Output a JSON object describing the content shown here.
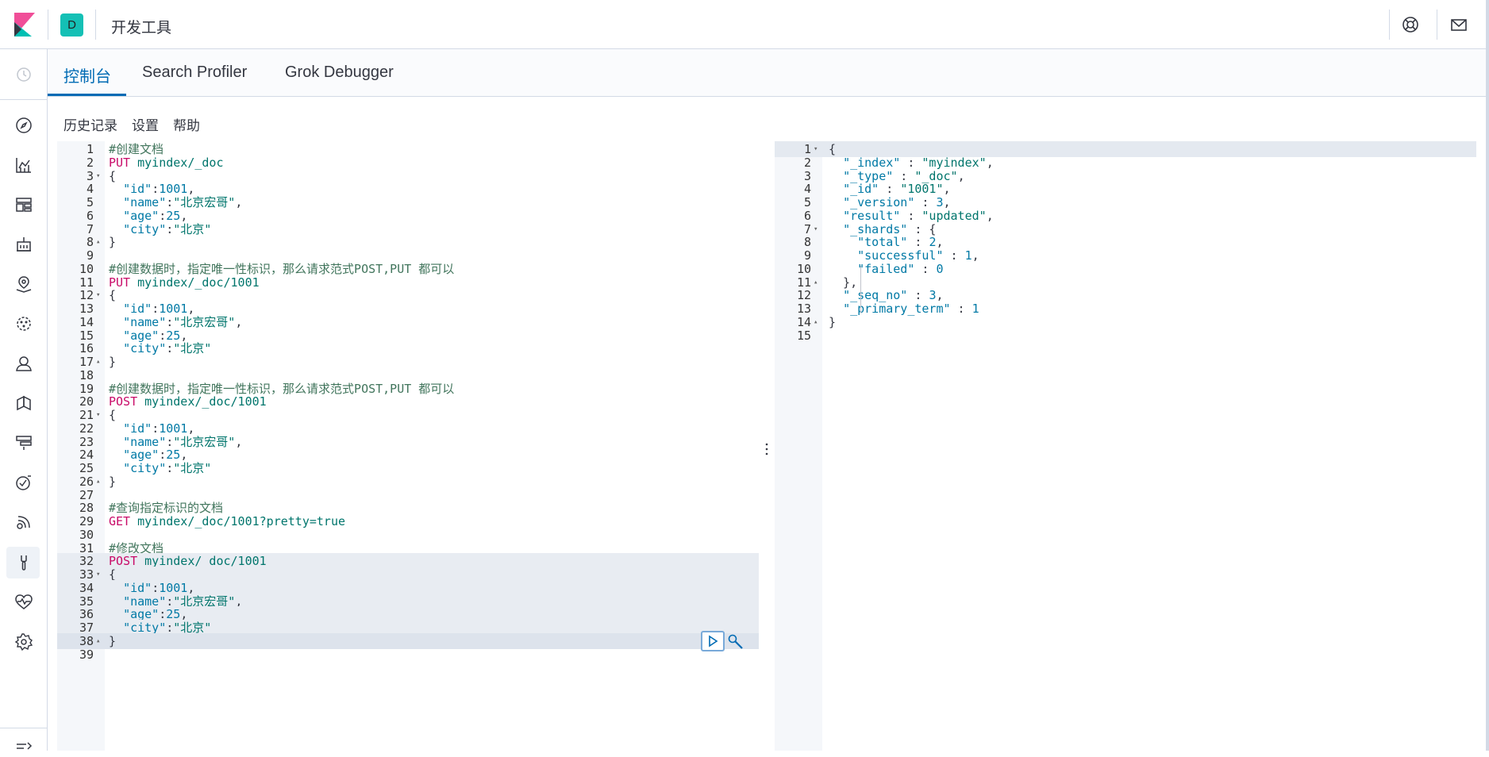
{
  "header": {
    "space_initial": "D",
    "app_title": "开发工具",
    "icons": [
      "kibana-logo-icon",
      "help-lifebuoy-icon",
      "mail-icon"
    ]
  },
  "sidenav": {
    "icons": [
      "clock-icon",
      "compass-icon",
      "visualize-icon",
      "dashboard-icon",
      "canvas-icon",
      "maps-icon",
      "ml-icon",
      "metrics-icon",
      "logs-icon",
      "apm-icon",
      "uptime-icon",
      "siem-icon",
      "dev-tools-icon",
      "monitoring-icon",
      "settings-gear-icon",
      "collapse-icon"
    ]
  },
  "tabs": [
    {
      "label": "控制台",
      "active": true
    },
    {
      "label": "Search Profiler",
      "active": false
    },
    {
      "label": "Grok Debugger",
      "active": false
    }
  ],
  "subnav": {
    "history": "历史记录",
    "settings": "设置",
    "help": "帮助"
  },
  "editor": {
    "lines": [
      {
        "n": "1",
        "fold": "",
        "tokens": [
          [
            "#创建文档",
            "comment"
          ]
        ]
      },
      {
        "n": "2",
        "fold": "",
        "tokens": [
          [
            "PUT ",
            "method"
          ],
          [
            "myindex/_doc",
            "path"
          ]
        ]
      },
      {
        "n": "3",
        "fold": "▾",
        "tokens": [
          [
            "{",
            "punc"
          ]
        ]
      },
      {
        "n": "4",
        "fold": "",
        "tokens": [
          [
            "  ",
            "punc"
          ],
          [
            "\"id\"",
            "key"
          ],
          [
            ":",
            "punc"
          ],
          [
            "1001",
            "num"
          ],
          [
            ",",
            "punc"
          ]
        ]
      },
      {
        "n": "5",
        "fold": "",
        "tokens": [
          [
            "  ",
            "punc"
          ],
          [
            "\"name\"",
            "key"
          ],
          [
            ":",
            "punc"
          ],
          [
            "\"北京宏哥\"",
            "str"
          ],
          [
            ",",
            "punc"
          ]
        ]
      },
      {
        "n": "6",
        "fold": "",
        "tokens": [
          [
            "  ",
            "punc"
          ],
          [
            "\"age\"",
            "key"
          ],
          [
            ":",
            "punc"
          ],
          [
            "25",
            "num"
          ],
          [
            ",",
            "punc"
          ]
        ]
      },
      {
        "n": "7",
        "fold": "",
        "tokens": [
          [
            "  ",
            "punc"
          ],
          [
            "\"city\"",
            "key"
          ],
          [
            ":",
            "punc"
          ],
          [
            "\"北京\"",
            "str"
          ]
        ]
      },
      {
        "n": "8",
        "fold": "▴",
        "tokens": [
          [
            "}",
            "punc"
          ]
        ]
      },
      {
        "n": "9",
        "fold": "",
        "tokens": []
      },
      {
        "n": "10",
        "fold": "",
        "tokens": [
          [
            "#创建数据时，指定唯一性标识，那么请求范式POST,PUT 都可以",
            "comment"
          ]
        ]
      },
      {
        "n": "11",
        "fold": "",
        "tokens": [
          [
            "PUT ",
            "method"
          ],
          [
            "myindex/_doc/1001",
            "path"
          ]
        ]
      },
      {
        "n": "12",
        "fold": "▾",
        "tokens": [
          [
            "{",
            "punc"
          ]
        ]
      },
      {
        "n": "13",
        "fold": "",
        "tokens": [
          [
            "  ",
            "punc"
          ],
          [
            "\"id\"",
            "key"
          ],
          [
            ":",
            "punc"
          ],
          [
            "1001",
            "num"
          ],
          [
            ",",
            "punc"
          ]
        ]
      },
      {
        "n": "14",
        "fold": "",
        "tokens": [
          [
            "  ",
            "punc"
          ],
          [
            "\"name\"",
            "key"
          ],
          [
            ":",
            "punc"
          ],
          [
            "\"北京宏哥\"",
            "str"
          ],
          [
            ",",
            "punc"
          ]
        ]
      },
      {
        "n": "15",
        "fold": "",
        "tokens": [
          [
            "  ",
            "punc"
          ],
          [
            "\"age\"",
            "key"
          ],
          [
            ":",
            "punc"
          ],
          [
            "25",
            "num"
          ],
          [
            ",",
            "punc"
          ]
        ]
      },
      {
        "n": "16",
        "fold": "",
        "tokens": [
          [
            "  ",
            "punc"
          ],
          [
            "\"city\"",
            "key"
          ],
          [
            ":",
            "punc"
          ],
          [
            "\"北京\"",
            "str"
          ]
        ]
      },
      {
        "n": "17",
        "fold": "▴",
        "tokens": [
          [
            "}",
            "punc"
          ]
        ]
      },
      {
        "n": "18",
        "fold": "",
        "tokens": []
      },
      {
        "n": "19",
        "fold": "",
        "tokens": [
          [
            "#创建数据时，指定唯一性标识，那么请求范式POST,PUT 都可以",
            "comment"
          ]
        ]
      },
      {
        "n": "20",
        "fold": "",
        "tokens": [
          [
            "POST ",
            "method"
          ],
          [
            "myindex/_doc/1001",
            "path"
          ]
        ]
      },
      {
        "n": "21",
        "fold": "▾",
        "tokens": [
          [
            "{",
            "punc"
          ]
        ]
      },
      {
        "n": "22",
        "fold": "",
        "tokens": [
          [
            "  ",
            "punc"
          ],
          [
            "\"id\"",
            "key"
          ],
          [
            ":",
            "punc"
          ],
          [
            "1001",
            "num"
          ],
          [
            ",",
            "punc"
          ]
        ]
      },
      {
        "n": "23",
        "fold": "",
        "tokens": [
          [
            "  ",
            "punc"
          ],
          [
            "\"name\"",
            "key"
          ],
          [
            ":",
            "punc"
          ],
          [
            "\"北京宏哥\"",
            "str"
          ],
          [
            ",",
            "punc"
          ]
        ]
      },
      {
        "n": "24",
        "fold": "",
        "tokens": [
          [
            "  ",
            "punc"
          ],
          [
            "\"age\"",
            "key"
          ],
          [
            ":",
            "punc"
          ],
          [
            "25",
            "num"
          ],
          [
            ",",
            "punc"
          ]
        ]
      },
      {
        "n": "25",
        "fold": "",
        "tokens": [
          [
            "  ",
            "punc"
          ],
          [
            "\"city\"",
            "key"
          ],
          [
            ":",
            "punc"
          ],
          [
            "\"北京\"",
            "str"
          ]
        ]
      },
      {
        "n": "26",
        "fold": "▴",
        "tokens": [
          [
            "}",
            "punc"
          ]
        ]
      },
      {
        "n": "27",
        "fold": "",
        "tokens": []
      },
      {
        "n": "28",
        "fold": "",
        "tokens": [
          [
            "#查询指定标识的文档",
            "comment"
          ]
        ]
      },
      {
        "n": "29",
        "fold": "",
        "tokens": [
          [
            "GET ",
            "method"
          ],
          [
            "myindex/_doc/1001?pretty=true",
            "path"
          ]
        ]
      },
      {
        "n": "30",
        "fold": "",
        "tokens": []
      },
      {
        "n": "31",
        "fold": "",
        "tokens": [
          [
            "#修改文档",
            "comment"
          ]
        ]
      },
      {
        "n": "32",
        "fold": "",
        "hl": true,
        "tokens": [
          [
            "POST ",
            "method"
          ],
          [
            "myindex/_doc/1001",
            "path"
          ]
        ]
      },
      {
        "n": "33",
        "fold": "▾",
        "hl": true,
        "tokens": [
          [
            "{",
            "punc"
          ]
        ]
      },
      {
        "n": "34",
        "fold": "",
        "hl": true,
        "tokens": [
          [
            "  ",
            "punc"
          ],
          [
            "\"id\"",
            "key"
          ],
          [
            ":",
            "punc"
          ],
          [
            "1001",
            "num"
          ],
          [
            ",",
            "punc"
          ]
        ]
      },
      {
        "n": "35",
        "fold": "",
        "hl": true,
        "tokens": [
          [
            "  ",
            "punc"
          ],
          [
            "\"name\"",
            "key"
          ],
          [
            ":",
            "punc"
          ],
          [
            "\"北京宏哥\"",
            "str"
          ],
          [
            ",",
            "punc"
          ]
        ]
      },
      {
        "n": "36",
        "fold": "",
        "hl": true,
        "tokens": [
          [
            "  ",
            "punc"
          ],
          [
            "\"age\"",
            "key"
          ],
          [
            ":",
            "punc"
          ],
          [
            "25",
            "num"
          ],
          [
            ",",
            "punc"
          ]
        ]
      },
      {
        "n": "37",
        "fold": "",
        "hl": true,
        "tokens": [
          [
            "  ",
            "punc"
          ],
          [
            "\"city\"",
            "key"
          ],
          [
            ":",
            "punc"
          ],
          [
            "\"北京\"",
            "str"
          ]
        ]
      },
      {
        "n": "38",
        "fold": "▴",
        "hl": "strong",
        "tokens": [
          [
            "}",
            "punc"
          ]
        ]
      },
      {
        "n": "39",
        "fold": "",
        "tokens": []
      }
    ]
  },
  "output": {
    "lines": [
      {
        "n": "1",
        "fold": "▾",
        "tokens": [
          [
            "{",
            "punc"
          ]
        ]
      },
      {
        "n": "2",
        "fold": "",
        "tokens": [
          [
            "  ",
            "punc"
          ],
          [
            "\"_index\"",
            "key"
          ],
          [
            " : ",
            "punc"
          ],
          [
            "\"myindex\"",
            "str"
          ],
          [
            ",",
            "punc"
          ]
        ]
      },
      {
        "n": "3",
        "fold": "",
        "tokens": [
          [
            "  ",
            "punc"
          ],
          [
            "\"_type\"",
            "key"
          ],
          [
            " : ",
            "punc"
          ],
          [
            "\"_doc\"",
            "str"
          ],
          [
            ",",
            "punc"
          ]
        ]
      },
      {
        "n": "4",
        "fold": "",
        "tokens": [
          [
            "  ",
            "punc"
          ],
          [
            "\"_id\"",
            "key"
          ],
          [
            " : ",
            "punc"
          ],
          [
            "\"1001\"",
            "str"
          ],
          [
            ",",
            "punc"
          ]
        ]
      },
      {
        "n": "5",
        "fold": "",
        "tokens": [
          [
            "  ",
            "punc"
          ],
          [
            "\"_version\"",
            "key"
          ],
          [
            " : ",
            "punc"
          ],
          [
            "3",
            "num"
          ],
          [
            ",",
            "punc"
          ]
        ]
      },
      {
        "n": "6",
        "fold": "",
        "tokens": [
          [
            "  ",
            "punc"
          ],
          [
            "\"result\"",
            "key"
          ],
          [
            " : ",
            "punc"
          ],
          [
            "\"updated\"",
            "str"
          ],
          [
            ",",
            "punc"
          ]
        ]
      },
      {
        "n": "7",
        "fold": "▾",
        "tokens": [
          [
            "  ",
            "punc"
          ],
          [
            "\"_shards\"",
            "key"
          ],
          [
            " : {",
            "punc"
          ]
        ]
      },
      {
        "n": "8",
        "fold": "",
        "tokens": [
          [
            "    ",
            "punc"
          ],
          [
            "\"total\"",
            "key"
          ],
          [
            " : ",
            "punc"
          ],
          [
            "2",
            "num"
          ],
          [
            ",",
            "punc"
          ]
        ]
      },
      {
        "n": "9",
        "fold": "",
        "tokens": [
          [
            "    ",
            "punc"
          ],
          [
            "\"successful\"",
            "key"
          ],
          [
            " : ",
            "punc"
          ],
          [
            "1",
            "num"
          ],
          [
            ",",
            "punc"
          ]
        ]
      },
      {
        "n": "10",
        "fold": "",
        "tokens": [
          [
            "    ",
            "punc"
          ],
          [
            "\"failed\"",
            "key"
          ],
          [
            " : ",
            "punc"
          ],
          [
            "0",
            "num"
          ]
        ]
      },
      {
        "n": "11",
        "fold": "▴",
        "tokens": [
          [
            "  },",
            "punc"
          ]
        ]
      },
      {
        "n": "12",
        "fold": "",
        "tokens": [
          [
            "  ",
            "punc"
          ],
          [
            "\"_seq_no\"",
            "key"
          ],
          [
            " : ",
            "punc"
          ],
          [
            "3",
            "num"
          ],
          [
            ",",
            "punc"
          ]
        ]
      },
      {
        "n": "13",
        "fold": "",
        "tokens": [
          [
            "  ",
            "punc"
          ],
          [
            "\"_primary_term\"",
            "key"
          ],
          [
            " : ",
            "punc"
          ],
          [
            "1",
            "num"
          ]
        ]
      },
      {
        "n": "14",
        "fold": "▴",
        "tokens": [
          [
            "}",
            "punc"
          ]
        ]
      },
      {
        "n": "15",
        "fold": "",
        "tokens": []
      }
    ]
  },
  "colors": {
    "accent": "#006bb4",
    "space_badge": "#14c0b5",
    "method": "#c80a68",
    "comment": "#41755c",
    "key": "#0079a5",
    "string": "#00756c"
  }
}
